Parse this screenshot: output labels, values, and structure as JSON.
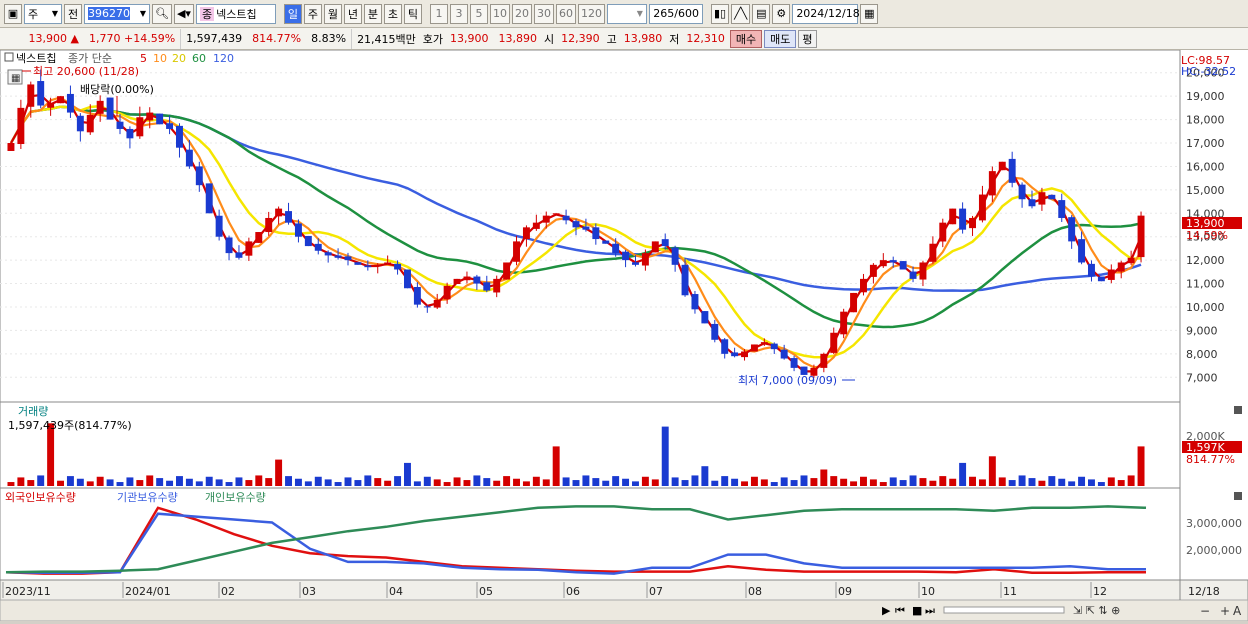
{
  "toolbar": {
    "period_select": "주",
    "prev_label": "전",
    "stock_code": "396270",
    "stock_name": "넥스트칩",
    "name_tag": "종",
    "periods": [
      "일",
      "주",
      "월",
      "년",
      "분",
      "초",
      "틱"
    ],
    "active_period": "일",
    "intervals": [
      "1",
      "3",
      "5",
      "10",
      "20",
      "30",
      "60",
      "120"
    ],
    "candle_count": "265",
    "candle_total": "/600",
    "date": "2024/12/18"
  },
  "quote": {
    "price": "13,900",
    "change": "1,770",
    "change_pct": "+14.59%",
    "volume": "1,597,439",
    "volume_ratio": "814.77%",
    "turnover": "8.83%",
    "amount": "21,415백만",
    "ask_label": "호가",
    "ask": "13,900",
    "bid": "13,890",
    "open_label": "시",
    "open": "12,390",
    "high_label": "고",
    "high": "13,980",
    "low_label": "저",
    "low": "12,310",
    "buy_label": "매수",
    "sell_label": "매도",
    "flat_label": "평"
  },
  "price_panel": {
    "name": "넥스트칩",
    "legend_prefix": "종가 단순",
    "ma_labels": [
      "5",
      "10",
      "20",
      "60",
      "120"
    ],
    "high_annotation": "최고 20,600 (11/28)",
    "dividend_annotation": "배당락(0.00%)",
    "low_annotation": "최저 7,000 (09/09)",
    "lc_label": "LC:98.57",
    "hc_label": "HC:-32.52",
    "current_price_label": "13,900",
    "current_pct_label": "14.59%"
  },
  "volume_panel": {
    "title": "거래량",
    "value_label": "1,597,439주(814.77%)",
    "scale_label": "2,000K",
    "current_label": "1,597K",
    "current_pct": "814.77%"
  },
  "holdings_panel": {
    "legends": [
      "외국인보유수량",
      "기관보유수량",
      "개인보유수량"
    ],
    "scale_labels": [
      "3,000,000",
      "2,000,000"
    ]
  },
  "x_axis_labels": [
    "2023/11",
    "2024/01",
    "02",
    "03",
    "04",
    "05",
    "06",
    "07",
    "08",
    "09",
    "10",
    "11",
    "12",
    "12/18"
  ],
  "colors": {
    "up": "#d40000",
    "down": "#1a3ad0",
    "ma5": "#d40000",
    "ma10": "#ff8c1a",
    "ma20": "#f5e600",
    "ma60": "#1e9040",
    "ma120": "#3a5ee0",
    "foreign": "#e01010",
    "institution": "#3a5ee0",
    "individual": "#2e8b57"
  },
  "chart_data": [
    {
      "type": "candlestick",
      "title": "넥스트칩",
      "y_ticks": [
        7000,
        8000,
        9000,
        10000,
        11000,
        12000,
        13000,
        14000,
        15000,
        16000,
        17000,
        18000,
        19000,
        20000
      ],
      "ylim": [
        6200,
        20800
      ],
      "close_series": [
        17000,
        18500,
        19500,
        18600,
        18700,
        19000,
        18300,
        17500,
        18200,
        18800,
        18000,
        17600,
        17200,
        18100,
        18300,
        17800,
        17600,
        16800,
        16000,
        15200,
        14000,
        13000,
        12300,
        12100,
        12800,
        13200,
        13800,
        14200,
        13600,
        13000,
        12600,
        12400,
        12200,
        12100,
        12000,
        11800,
        11700,
        11800,
        11900,
        11600,
        10800,
        10100,
        10000,
        10300,
        10900,
        11200,
        11300,
        11000,
        10700,
        11200,
        11900,
        12800,
        13400,
        13600,
        13900,
        14000,
        13700,
        13400,
        13300,
        12900,
        12700,
        12300,
        12000,
        11800,
        12300,
        12800,
        12600,
        11800,
        10500,
        9900,
        9300,
        8600,
        8000,
        7900,
        8100,
        8400,
        8500,
        8200,
        7800,
        7400,
        7100,
        7400,
        8000,
        8900,
        9800,
        10600,
        11200,
        11800,
        12000,
        11900,
        11600,
        11200,
        11900,
        12700,
        13600,
        14200,
        13300,
        13800,
        14800,
        15800,
        16200,
        15300,
        14600,
        14300,
        14900,
        14600,
        13800,
        12800,
        11900,
        11300,
        11100,
        11600,
        11900,
        12100,
        13900
      ],
      "moving_averages": [
        "5",
        "10",
        "20",
        "60",
        "120"
      ]
    },
    {
      "type": "bar",
      "title": "거래량",
      "note": "daily volume, last bar 1,597,439"
    },
    {
      "type": "line",
      "series": [
        {
          "name": "외국인보유수량",
          "values": [
            1500000,
            1450000,
            1450000,
            1500000,
            3700000,
            3300000,
            2800000,
            2400000,
            2150000,
            2050000,
            2000000,
            1850000,
            1700000,
            1650000,
            1600000,
            1550000,
            1520000,
            1520000,
            1520000,
            1700000,
            1580000,
            1520000,
            1520000,
            1520000,
            1520000,
            1500000,
            1600000,
            1480000,
            1480000,
            1500000,
            1500000
          ]
        },
        {
          "name": "기관보유수량",
          "values": [
            1500000,
            1480000,
            1480000,
            1500000,
            3500000,
            3400000,
            3300000,
            3200000,
            2300000,
            1850000,
            1850000,
            1800000,
            1650000,
            1600000,
            1580000,
            1500000,
            1450000,
            1650000,
            1650000,
            2100000,
            2100000,
            1800000,
            1650000,
            1650000,
            1650000,
            1650000,
            1650000,
            1650000,
            1700000,
            1600000,
            1600000
          ]
        },
        {
          "name": "개인보유수량",
          "values": [
            1500000,
            1520000,
            1520000,
            1550000,
            1600000,
            1900000,
            2200000,
            2500000,
            2700000,
            2900000,
            3050000,
            3250000,
            3400000,
            3550000,
            3700000,
            3750000,
            3750000,
            3650000,
            3650000,
            3300000,
            3450000,
            3600000,
            3650000,
            3650000,
            3650000,
            3650000,
            3600000,
            3700000,
            3700000,
            3750000,
            3700000
          ]
        }
      ]
    }
  ]
}
